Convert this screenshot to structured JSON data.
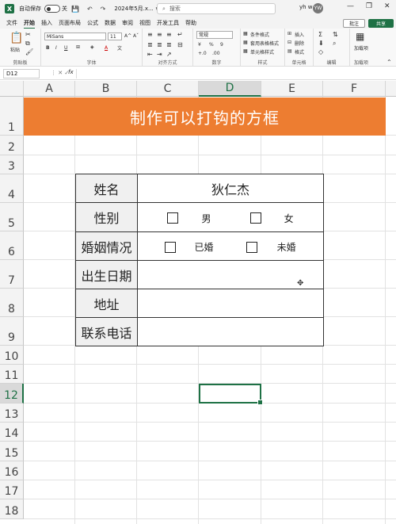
{
  "titlebar": {
    "app_icon": "X",
    "autosave_label": "自动保存",
    "autosave_state": "关",
    "file_name": "2024年5月.x... ∨",
    "search_placeholder": "搜索",
    "user_name": "yh w",
    "user_initials": "YW",
    "minimize": "—",
    "restore": "❐",
    "close": "✕"
  },
  "menu": {
    "items": [
      "文件",
      "开始",
      "插入",
      "页面布局",
      "公式",
      "数据",
      "审阅",
      "视图",
      "开发工具",
      "帮助"
    ],
    "active": "开始",
    "comment_label": "批注",
    "share_label": "共享"
  },
  "ribbon": {
    "clipboard": {
      "paste": "粘贴",
      "label": "剪贴板"
    },
    "font": {
      "font_name": "MiSans",
      "font_size": "11",
      "bold": "B",
      "italic": "I",
      "underline": "U",
      "grow": "A^",
      "shrink": "Aˇ",
      "font_color": "A",
      "label": "字体"
    },
    "alignment": {
      "label": "对齐方式"
    },
    "number": {
      "format": "常规",
      "percent": "%",
      "comma": "9",
      "label": "数字"
    },
    "styles": {
      "conditional": "条件格式",
      "table": "套用表格格式",
      "cell_styles": "单元格样式",
      "label": "样式"
    },
    "cells": {
      "insert": "插入",
      "delete": "删除",
      "format": "格式",
      "label": "单元格"
    },
    "editing": {
      "sum": "Σ",
      "label": "编辑"
    },
    "addins": {
      "add": "加载项",
      "label": "加载项"
    }
  },
  "formula_bar": {
    "name_box": "D12",
    "fx": "fx",
    "value": ""
  },
  "sheet": {
    "columns": [
      "A",
      "B",
      "C",
      "D",
      "E",
      "F"
    ],
    "selected_column": "D",
    "rows": [
      "1",
      "2",
      "3",
      "4",
      "5",
      "6",
      "7",
      "8",
      "9",
      "10",
      "11",
      "12",
      "13",
      "14",
      "15",
      "16",
      "17",
      "18"
    ],
    "selected_row": "12",
    "title": "制作可以打钩的方框"
  },
  "form": {
    "name_label": "姓名",
    "name_value": "狄仁杰",
    "gender_label": "性别",
    "gender_opt1": "男",
    "gender_opt2": "女",
    "marital_label": "婚姻情况",
    "marital_opt1": "已婚",
    "marital_opt2": "未婚",
    "birth_label": "出生日期",
    "birth_value": "",
    "address_label": "地址",
    "address_value": "",
    "phone_label": "联系电话",
    "phone_value": ""
  },
  "colors": {
    "title_bg": "#ed7d31",
    "excel_green": "#1e7145"
  }
}
